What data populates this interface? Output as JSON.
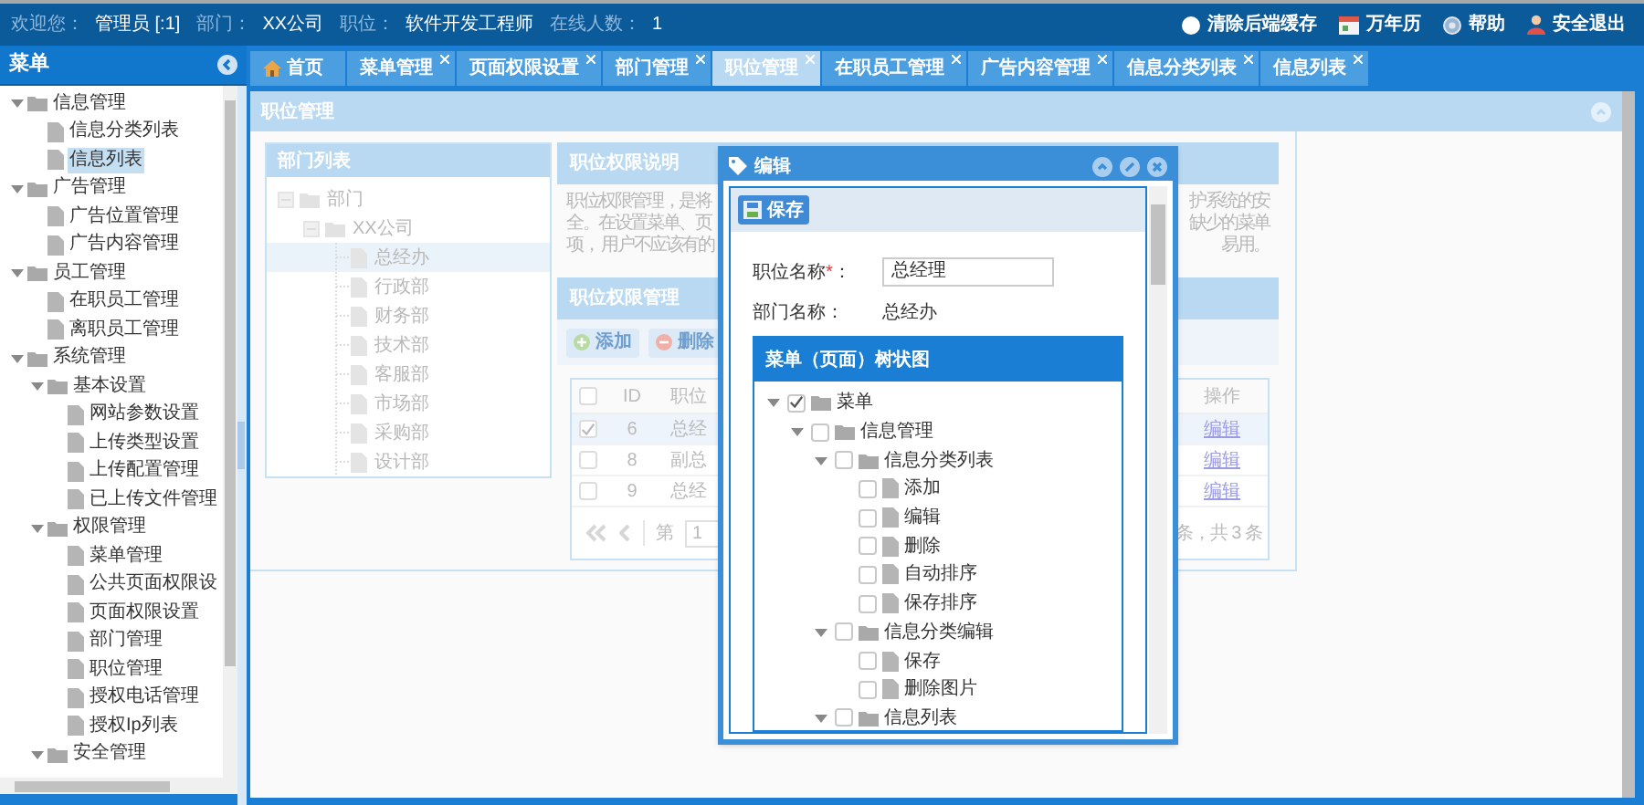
{
  "top_bar": {
    "fields": [
      {
        "label": "欢迎您：",
        "value": "管理员 [:1]"
      },
      {
        "label": "部门：",
        "value": "XX公司"
      },
      {
        "label": "职位：",
        "value": "软件开发工程师"
      },
      {
        "label": "在线人数：",
        "value": "1"
      }
    ],
    "actions": [
      {
        "kind": "clear",
        "label": "清除后端缓存"
      },
      {
        "kind": "calendar",
        "label": "万年历"
      },
      {
        "kind": "help",
        "label": "帮助"
      },
      {
        "kind": "logout",
        "label": "安全退出"
      }
    ]
  },
  "sidebar": {
    "title": "菜单",
    "items": [
      {
        "label": "信息管理",
        "expanded": true,
        "selected": false,
        "children": [
          {
            "label": "信息分类列表",
            "selected": false
          },
          {
            "label": "信息列表",
            "selected": true
          }
        ]
      },
      {
        "label": "广告管理",
        "expanded": true,
        "selected": false,
        "children": [
          {
            "label": "广告位置管理",
            "selected": false
          },
          {
            "label": "广告内容管理",
            "selected": false
          }
        ]
      },
      {
        "label": "员工管理",
        "expanded": true,
        "selected": false,
        "children": [
          {
            "label": "在职员工管理",
            "selected": false
          },
          {
            "label": "离职员工管理",
            "selected": false
          }
        ]
      },
      {
        "label": "系统管理",
        "expanded": true,
        "selected": false,
        "children": [
          {
            "label": "基本设置",
            "expanded": true,
            "selected": false,
            "children": [
              {
                "label": "网站参数设置",
                "selected": false
              },
              {
                "label": "上传类型设置",
                "selected": false
              },
              {
                "label": "上传配置管理",
                "selected": false
              },
              {
                "label": "已上传文件管理",
                "selected": false
              }
            ]
          },
          {
            "label": "权限管理",
            "expanded": true,
            "selected": false,
            "children": [
              {
                "label": "菜单管理",
                "selected": false
              },
              {
                "label": "公共页面权限设",
                "selected": false
              },
              {
                "label": "页面权限设置",
                "selected": false
              },
              {
                "label": "部门管理",
                "selected": false
              },
              {
                "label": "职位管理",
                "selected": false
              },
              {
                "label": "授权电话管理",
                "selected": false
              },
              {
                "label": "授权Ip列表",
                "selected": false
              }
            ]
          },
          {
            "label": "安全管理",
            "expanded": true,
            "selected": false
          }
        ]
      }
    ]
  },
  "tabs": [
    {
      "kind": "home",
      "label": "首页",
      "selected": false
    },
    {
      "kind": "closable",
      "label": "菜单管理",
      "selected": false
    },
    {
      "kind": "closable",
      "label": "页面权限设置",
      "selected": false
    },
    {
      "kind": "closable",
      "label": "部门管理",
      "selected": false
    },
    {
      "kind": "closable",
      "label": "职位管理",
      "selected": true
    },
    {
      "kind": "closable",
      "label": "在职员工管理",
      "selected": false
    },
    {
      "kind": "closable",
      "label": "广告内容管理",
      "selected": false
    },
    {
      "kind": "closable",
      "label": "信息分类列表",
      "selected": false
    },
    {
      "kind": "closable",
      "label": "信息列表",
      "selected": false
    }
  ],
  "panel": {
    "title": "职位管理",
    "dept_list": {
      "title": "部门列表",
      "tree": [
        {
          "label": "部门",
          "expanded": true,
          "selected": false,
          "children": [
            {
              "label": "XX公司",
              "expanded": true,
              "selected": false,
              "children": [
                {
                  "label": "总经办",
                  "selected": true
                },
                {
                  "label": "行政部",
                  "selected": false
                },
                {
                  "label": "财务部",
                  "selected": false
                },
                {
                  "label": "技术部",
                  "selected": false
                },
                {
                  "label": "客服部",
                  "selected": false
                },
                {
                  "label": "市场部",
                  "selected": false
                },
                {
                  "label": "采购部",
                  "selected": false
                },
                {
                  "label": "设计部",
                  "selected": false
                }
              ]
            }
          ]
        }
      ]
    },
    "description": {
      "title": "职位权限说明",
      "lines": [
        {
          "start": "职位权限管理，是将",
          "end": "护系统的安"
        },
        {
          "start": "全。在设置菜单、页",
          "end": "缺少的菜单"
        },
        {
          "start": "项， 用户不应该有的",
          "end": "易用。"
        }
      ]
    },
    "grid": {
      "title": "职位权限管理",
      "toolbar": [
        {
          "kind": "add",
          "label": "添加"
        },
        {
          "kind": "delete",
          "label": "删除"
        }
      ],
      "header_checked": false,
      "columns": [
        "ID",
        "职位",
        "操作"
      ],
      "rows": [
        {
          "id": "6",
          "name": "总经",
          "action": "编辑",
          "checked": true
        },
        {
          "id": "8",
          "name": "副总",
          "action": "编辑",
          "checked": false
        },
        {
          "id": "9",
          "name": "总经",
          "action": "编辑",
          "checked": false
        }
      ],
      "pager": {
        "page_label": "第",
        "page": "1",
        "summary": "条，共 3 条"
      }
    }
  },
  "dialog": {
    "title": "编辑",
    "save": "保存",
    "fields": [
      {
        "label": "职位名称",
        "mark": "*",
        "suffix": "：",
        "kind": "input",
        "value": "总经理"
      },
      {
        "label": "部门名称：",
        "kind": "text",
        "value": "总经办"
      }
    ],
    "tree_title": "菜单（页面）树状图",
    "tree": [
      {
        "label": "菜单",
        "checked": true,
        "expanded": true,
        "children": [
          {
            "label": "信息管理",
            "checked": false,
            "expanded": true,
            "children": [
              {
                "label": "信息分类列表",
                "checked": false,
                "expanded": true,
                "children": [
                  {
                    "label": "添加",
                    "checked": false
                  },
                  {
                    "label": "编辑",
                    "checked": false
                  },
                  {
                    "label": "删除",
                    "checked": false
                  },
                  {
                    "label": "自动排序",
                    "checked": false
                  },
                  {
                    "label": "保存排序",
                    "checked": false
                  }
                ]
              },
              {
                "label": "信息分类编辑",
                "checked": false,
                "expanded": true,
                "children": [
                  {
                    "label": "保存",
                    "checked": false
                  },
                  {
                    "label": "删除图片",
                    "checked": false
                  }
                ]
              },
              {
                "label": "信息列表",
                "checked": false,
                "expanded": true
              }
            ]
          }
        ]
      }
    ]
  }
}
